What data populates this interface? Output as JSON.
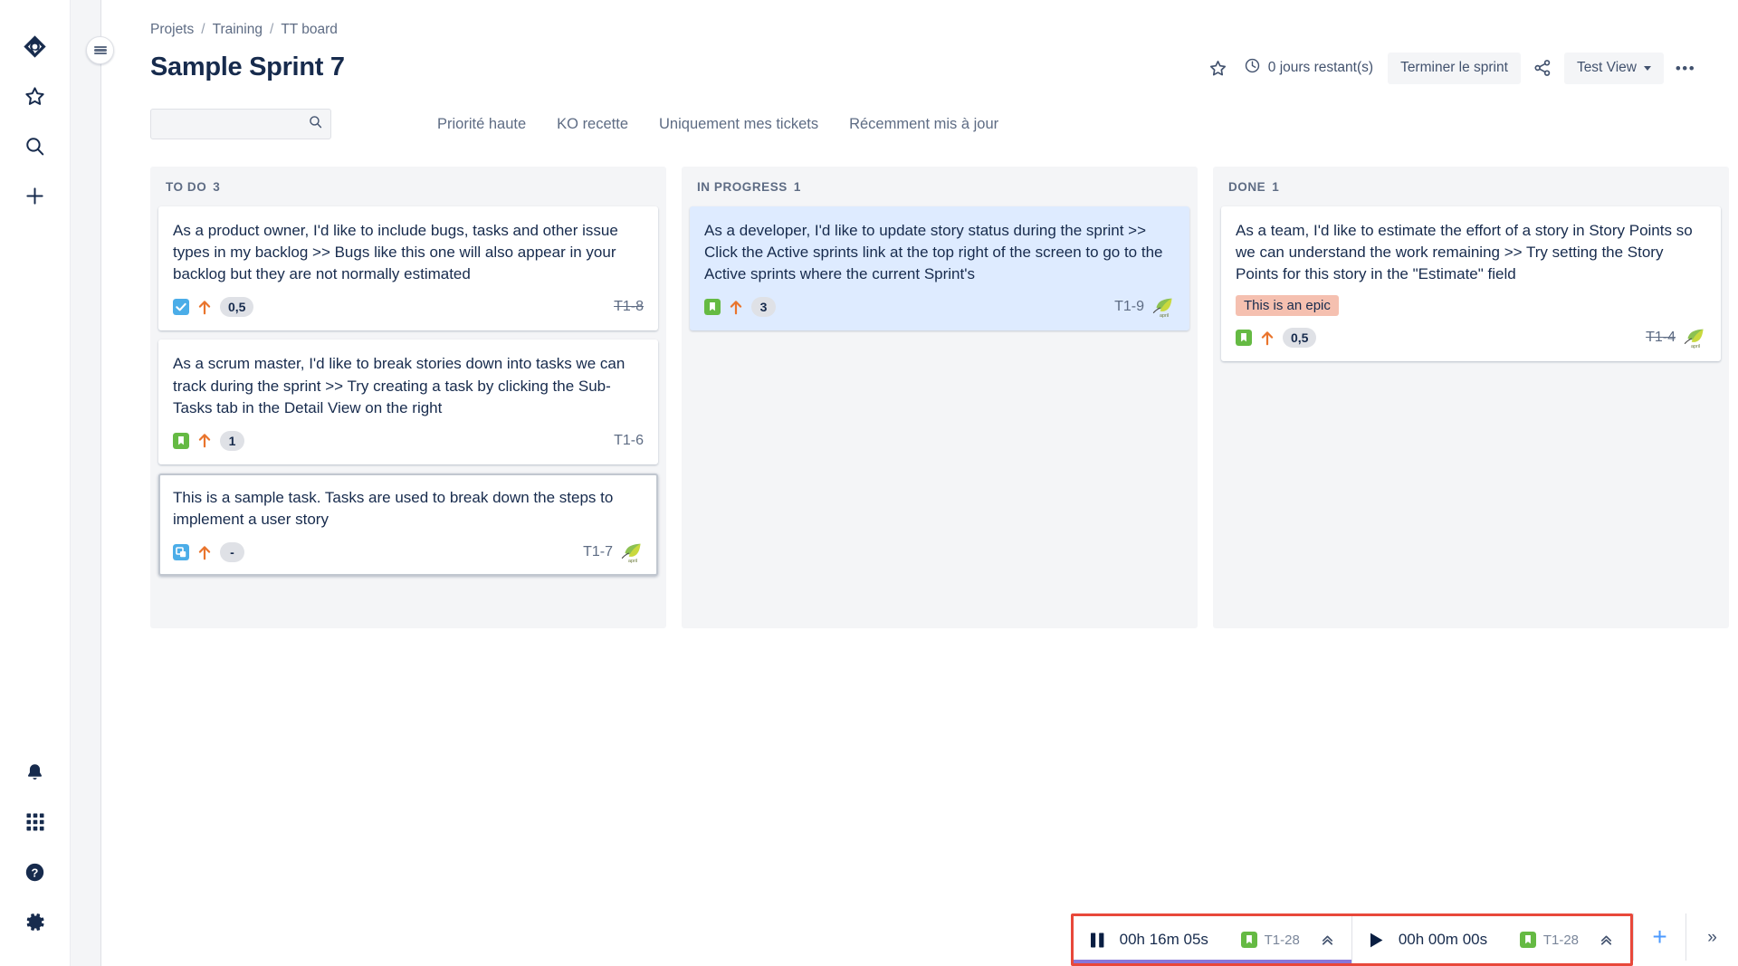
{
  "app": {
    "product_name": "Jira"
  },
  "globalnav": {
    "top_items": [
      {
        "name": "jira-logo-icon",
        "label": "Jira"
      },
      {
        "name": "starred-icon",
        "label": "Starred"
      },
      {
        "name": "search-icon",
        "label": "Search"
      },
      {
        "name": "create-icon",
        "label": "Create"
      }
    ],
    "bottom_items": [
      {
        "name": "notifications-bell-icon",
        "label": "Notifications"
      },
      {
        "name": "app-switcher-grid-icon",
        "label": "App switcher"
      },
      {
        "name": "help-question-icon",
        "label": "Help"
      },
      {
        "name": "settings-gear-icon",
        "label": "Settings"
      }
    ]
  },
  "panel": {
    "toggle_label": "Expand project sidebar"
  },
  "breadcrumb": {
    "items": [
      "Projets",
      "Training",
      "TT board"
    ],
    "separator": "/"
  },
  "header": {
    "title": "Sample Sprint 7",
    "star_label": "Add to starred",
    "clock_icon": "clock-icon",
    "days_remaining": "0 jours restant(s)",
    "complete_sprint_label": "Terminer le sprint",
    "share_label": "Share",
    "view_label": "Test View",
    "more_label": "•••"
  },
  "filters": {
    "search_value": "",
    "search_placeholder": "",
    "quick_filters": [
      "Priorité haute",
      "KO recette",
      "Uniquement mes tickets",
      "Récemment mis à jour"
    ]
  },
  "board": {
    "columns": [
      {
        "id": "todo",
        "title": "TO DO",
        "count": "3",
        "cards": [
          {
            "summary": "As a product owner, I'd like to include bugs, tasks and other issue types in my backlog >> Bugs like this one will also appear in your backlog but they are not normally estimated",
            "type_icon": "task-checkbox-icon",
            "type_color": "#4bade8",
            "priority_icon": "priority-high-arrow-icon",
            "priority_color": "#e9742c",
            "estimate": "0,5",
            "key": "T1-8",
            "key_done": true,
            "epic": null,
            "avatar": false,
            "highlight": false,
            "selected": false
          },
          {
            "summary": "As a scrum master, I'd like to break stories down into tasks we can track during the sprint >> Try creating a task by clicking the Sub-Tasks tab in the Detail View on the right",
            "type_icon": "story-bookmark-icon",
            "type_color": "#65ba43",
            "priority_icon": "priority-high-arrow-icon",
            "priority_color": "#e9742c",
            "estimate": "1",
            "key": "T1-6",
            "key_done": false,
            "epic": null,
            "avatar": false,
            "highlight": false,
            "selected": false
          },
          {
            "summary": "This is a sample task. Tasks are used to break down the steps to implement a user story",
            "type_icon": "subtask-icon",
            "type_color": "#4bade8",
            "priority_icon": "priority-high-arrow-icon",
            "priority_color": "#e9742c",
            "estimate": "-",
            "key": "T1-7",
            "key_done": false,
            "epic": null,
            "avatar": true,
            "highlight": false,
            "selected": true
          }
        ]
      },
      {
        "id": "inprogress",
        "title": "IN PROGRESS",
        "count": "1",
        "cards": [
          {
            "summary": "As a developer, I'd like to update story status during the sprint >> Click the Active sprints link at the top right of the screen to go to the Active sprints where the current Sprint's",
            "type_icon": "story-bookmark-icon",
            "type_color": "#65ba43",
            "priority_icon": "priority-high-arrow-icon",
            "priority_color": "#e9742c",
            "estimate": "3",
            "key": "T1-9",
            "key_done": false,
            "epic": null,
            "avatar": true,
            "highlight": true,
            "selected": false
          }
        ]
      },
      {
        "id": "done",
        "title": "DONE",
        "count": "1",
        "cards": [
          {
            "summary": "As a team, I'd like to estimate the effort of a story in Story Points so we can understand the work remaining >> Try setting the Story Points for this story in the \"Estimate\" field",
            "type_icon": "story-bookmark-icon",
            "type_color": "#65ba43",
            "priority_icon": "priority-high-arrow-icon",
            "priority_color": "#e9742c",
            "estimate": "0,5",
            "key": "T1-4",
            "key_done": true,
            "epic": "This is an epic",
            "epic_color": "#f5c0b0",
            "avatar": true,
            "highlight": false,
            "selected": false
          }
        ]
      }
    ]
  },
  "timer_bar": {
    "timers": [
      {
        "state": "running",
        "control_icon": "pause-icon",
        "time": "00h 16m 05s",
        "issue_icon": "story-bookmark-icon",
        "issue_key": "T1-28",
        "expand_icon": "chevron-double-up-icon"
      },
      {
        "state": "paused",
        "control_icon": "play-icon",
        "time": "00h 00m 00s",
        "issue_icon": "story-bookmark-icon",
        "issue_key": "T1-28",
        "expand_icon": "chevron-double-up-icon"
      }
    ],
    "add_label": "+",
    "collapse_label": "»",
    "highlight_color": "#e8483a",
    "accent_color": "#8777d9"
  }
}
